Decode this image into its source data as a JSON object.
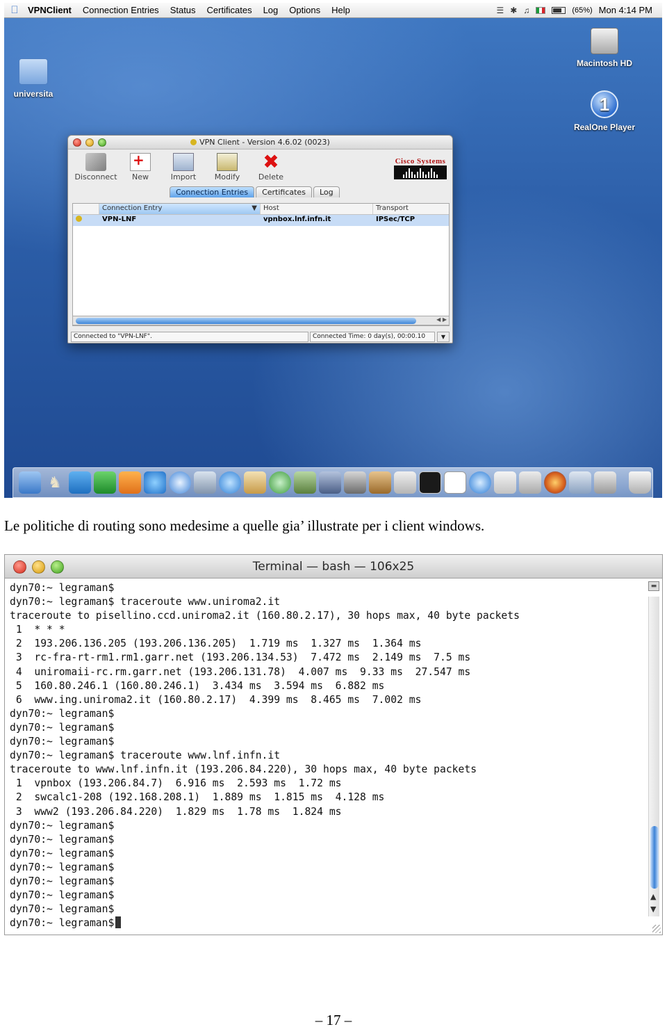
{
  "desktop": {
    "menubar": {
      "app_name": "VPNClient",
      "menus": [
        "Connection Entries",
        "Status",
        "Certificates",
        "Log",
        "Options",
        "Help"
      ],
      "battery": "(65%)",
      "clock": "Mon 4:14 PM"
    },
    "icons": {
      "folder_label": "universita",
      "hd_label": "Macintosh HD",
      "realone_label": "RealOne Player",
      "realone_glyph": "1"
    },
    "vpn_window": {
      "title": "VPN Client  -  Version 4.6.02 (0023)",
      "toolbar": {
        "disconnect": "Disconnect",
        "new": "New",
        "import": "Import",
        "modify": "Modify",
        "delete": "Delete"
      },
      "brand": "Cisco Systems",
      "tabs": [
        "Connection Entries",
        "Certificates",
        "Log"
      ],
      "columns": [
        "Connection Entry",
        "Host",
        "Transport"
      ],
      "rows": [
        {
          "entry": "VPN-LNF",
          "host": "vpnbox.lnf.infn.it",
          "transport": "IPSec/TCP"
        }
      ],
      "status_left": "Connected to \"VPN-LNF\".",
      "status_right": "Connected Time: 0 day(s), 00:00.10"
    },
    "dock_icons": [
      "finder-icon",
      "chess-icon",
      "wi-icon",
      "yahoo-icon",
      "p-icon",
      "ie-icon",
      "safari-icon",
      "preview-icon",
      "ichat-icon",
      "mail-icon",
      "itunes-icon",
      "iphoto-icon",
      "imovie-icon",
      "idvd-icon",
      "garageband-icon",
      "calculator-icon",
      "terminal-icon",
      "ical-icon",
      "quicktime-icon",
      "system-prefs-icon",
      "printer-icon",
      "firefox-icon",
      "vpn-icon",
      "network-icon",
      "trash-icon"
    ]
  },
  "caption": "Le politiche di routing sono medesime a quelle gia’ illustrate per i client windows.",
  "terminal": {
    "title": "Terminal — bash — 106x25",
    "lines": [
      "dyn70:~ legraman$",
      "dyn70:~ legraman$ traceroute www.uniroma2.it",
      "traceroute to pisellino.ccd.uniroma2.it (160.80.2.17), 30 hops max, 40 byte packets",
      " 1  * * *",
      " 2  193.206.136.205 (193.206.136.205)  1.719 ms  1.327 ms  1.364 ms",
      " 3  rc-fra-rt-rm1.rm1.garr.net (193.206.134.53)  7.472 ms  2.149 ms  7.5 ms",
      " 4  uniromaii-rc.rm.garr.net (193.206.131.78)  4.007 ms  9.33 ms  27.547 ms",
      " 5  160.80.246.1 (160.80.246.1)  3.434 ms  3.594 ms  6.882 ms",
      " 6  www.ing.uniroma2.it (160.80.2.17)  4.399 ms  8.465 ms  7.002 ms",
      "dyn70:~ legraman$",
      "dyn70:~ legraman$",
      "dyn70:~ legraman$",
      "dyn70:~ legraman$ traceroute www.lnf.infn.it",
      "traceroute to www.lnf.infn.it (193.206.84.220), 30 hops max, 40 byte packets",
      " 1  vpnbox (193.206.84.7)  6.916 ms  2.593 ms  1.72 ms",
      " 2  swcalc1-208 (192.168.208.1)  1.889 ms  1.815 ms  4.128 ms",
      " 3  www2 (193.206.84.220)  1.829 ms  1.78 ms  1.824 ms",
      "dyn70:~ legraman$",
      "dyn70:~ legraman$",
      "dyn70:~ legraman$",
      "dyn70:~ legraman$",
      "dyn70:~ legraman$",
      "dyn70:~ legraman$",
      "dyn70:~ legraman$",
      "dyn70:~ legraman$"
    ]
  },
  "page_number": "– 17 –"
}
